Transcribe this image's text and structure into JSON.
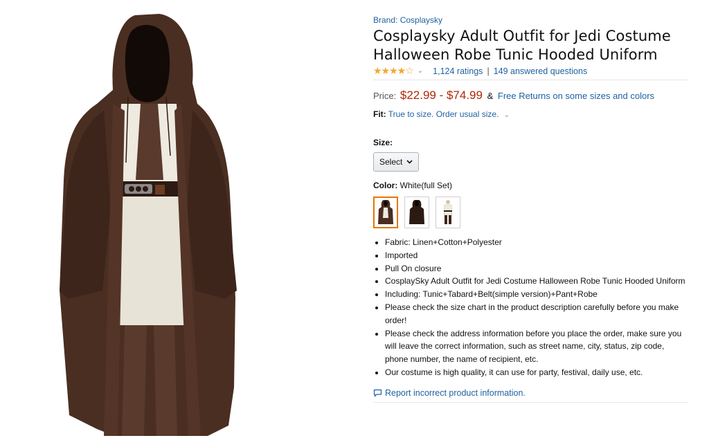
{
  "product": {
    "brand": "Brand: Cosplaysky",
    "title": "Cosplaysky Adult Outfit for Jedi Costume Halloween Robe Tunic Hooded Uniform",
    "rating_stars": "★★★★☆",
    "rating_chevron": "⌄",
    "ratings_count": "1,124 ratings",
    "separator": "|",
    "answered_questions": "149 answered questions",
    "price_label": "Price:",
    "price": "$22.99 - $74.99",
    "price_amp": "&",
    "free_returns": "Free Returns on some sizes and colors",
    "fit_label": "Fit:",
    "fit_value": "True to size. Order usual size.",
    "fit_chevron": "⌄",
    "size_label": "Size:",
    "size_select": "Select",
    "color_label": "Color:",
    "color_value": "White(full Set)",
    "bullets": [
      "Fabric: Linen+Cotton+Polyester",
      "Imported",
      "Pull On closure",
      "CosplaySky Adult Outfit for Jedi Costume Halloween Robe Tunic Hooded Uniform",
      "Including: Tunic+Tabard+Belt(simple version)+Pant+Robe",
      "Please check the size chart in the product description carefully before you make order!",
      "Please check the address information before you place the order, make sure you will leave the correct information, such as street name, city, status, zip code, phone number, the name of recipient, etc.",
      "Our costume is high quality, it can use for party, festival, daily use, etc."
    ],
    "report_link": "Report incorrect product information."
  },
  "icons": {
    "star_color": "#f2a532",
    "link_color": "#2162a1",
    "price_color": "#b12704",
    "selected_border": "#e77600",
    "robe_brown": "#4a2e22",
    "tunic_white": "#eeeae0"
  }
}
